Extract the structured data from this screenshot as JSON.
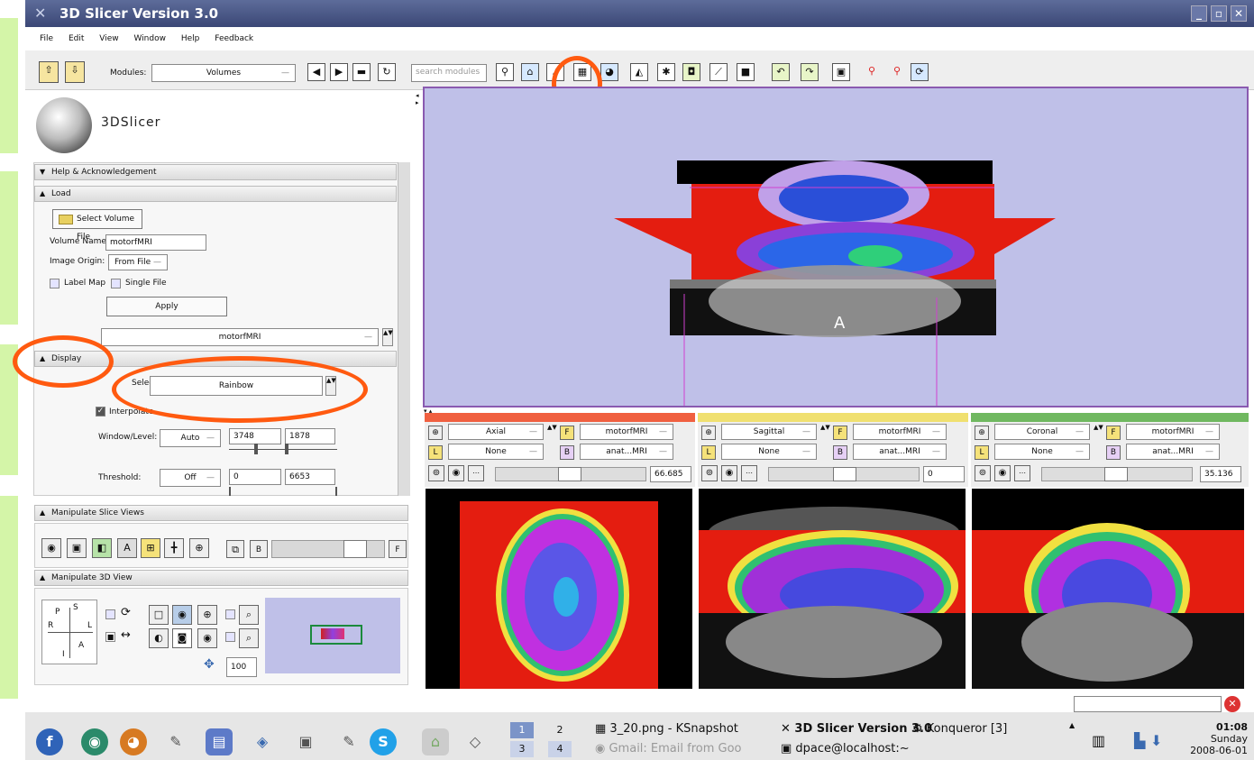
{
  "window": {
    "title": "3D Slicer Version 3.0",
    "minimize": "_",
    "restore": "▫",
    "close": "✕"
  },
  "menubar": [
    "File",
    "Edit",
    "View",
    "Window",
    "Help",
    "Feedback"
  ],
  "toolbar": {
    "modules_label": "Modules:",
    "modules_value": "Volumes",
    "search_placeholder": "search modules"
  },
  "logo": {
    "text": "3DSlicer"
  },
  "panels": {
    "help": "Help & Acknowledgement",
    "load": "Load",
    "display": "Display",
    "manipulate_slice": "Manipulate Slice Views",
    "manipulate_3d": "Manipulate 3D View"
  },
  "load": {
    "select_button": "Select Volume File",
    "volume_name_label": "Volume Name:",
    "volume_name_value": "motorfMRI",
    "image_origin_label": "Image Origin:",
    "image_origin_value": "From File",
    "label_map": "Label Map",
    "single_file": "Single File",
    "apply": "Apply"
  },
  "active_volume": {
    "value": "motorfMRI"
  },
  "display": {
    "select_label": "Select:",
    "colormap": "Rainbow",
    "interpolate_label": "Interpolate",
    "window_level_label": "Window/Level:",
    "window_level_mode": "Auto",
    "window_value": "3748",
    "level_value": "1878",
    "threshold_label": "Threshold:",
    "threshold_mode": "Off",
    "threshold_low": "0",
    "threshold_high": "6653"
  },
  "view3d_label": {
    "letter": "A"
  },
  "orient": {
    "P": "P",
    "S": "S",
    "R": "R",
    "L": "L",
    "I": "I",
    "A": "A"
  },
  "zoom_value": "100",
  "slices": [
    {
      "orientation": "Axial",
      "fg": "motorfMRI",
      "lb": "None",
      "bg": "anat...MRI",
      "offset": "66.685",
      "color": "#f06040"
    },
    {
      "orientation": "Sagittal",
      "fg": "motorfMRI",
      "lb": "None",
      "bg": "anat...MRI",
      "offset": "0",
      "color": "#f0e070"
    },
    {
      "orientation": "Coronal",
      "fg": "motorfMRI",
      "lb": "None",
      "bg": "anat...MRI",
      "offset": "35.136",
      "color": "#70b860"
    }
  ],
  "taskbar": {
    "desktops": [
      "1",
      "2",
      "3",
      "4"
    ],
    "tasks": [
      "3_20.png - KSnapshot",
      "3D Slicer Version 3.0",
      "Konqueror [3]",
      "Gmail: Email from Goo",
      "dpace@localhost:~"
    ],
    "clock": {
      "time": "01:08",
      "day": "Sunday",
      "date": "2008-06-01"
    }
  }
}
